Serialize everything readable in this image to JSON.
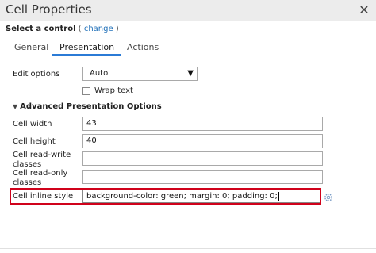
{
  "window": {
    "title": "Cell Properties",
    "close_glyph": "✕"
  },
  "control": {
    "label": "Select a control",
    "open_paren": "(",
    "change_link": "change",
    "close_paren": ")"
  },
  "tabs": [
    {
      "label": "General",
      "active": false
    },
    {
      "label": "Presentation",
      "active": true
    },
    {
      "label": "Actions",
      "active": false
    }
  ],
  "edit_options": {
    "label": "Edit options",
    "value": "Auto",
    "caret": "▼"
  },
  "wrap_text": {
    "label": "Wrap text",
    "checked": false
  },
  "advanced": {
    "caret": "▼",
    "label": "Advanced Presentation Options"
  },
  "fields": {
    "cell_width": {
      "label": "Cell width",
      "value": "43"
    },
    "cell_height": {
      "label": "Cell height",
      "value": "40"
    },
    "read_write": {
      "label_line1": "Cell read-write",
      "label_line2": "classes",
      "value": ""
    },
    "read_only": {
      "label_line1": "Cell read-only",
      "label_line2": "classes",
      "value": ""
    },
    "inline_style": {
      "label": "Cell inline style",
      "value": "background-color: green; margin: 0; padding: 0;"
    }
  },
  "colors": {
    "highlight": "#d0021b",
    "tab_accent": "#2b7bd6",
    "link": "#1e6fb8"
  },
  "icons": {
    "gear": "gear-icon",
    "close": "close-icon"
  }
}
